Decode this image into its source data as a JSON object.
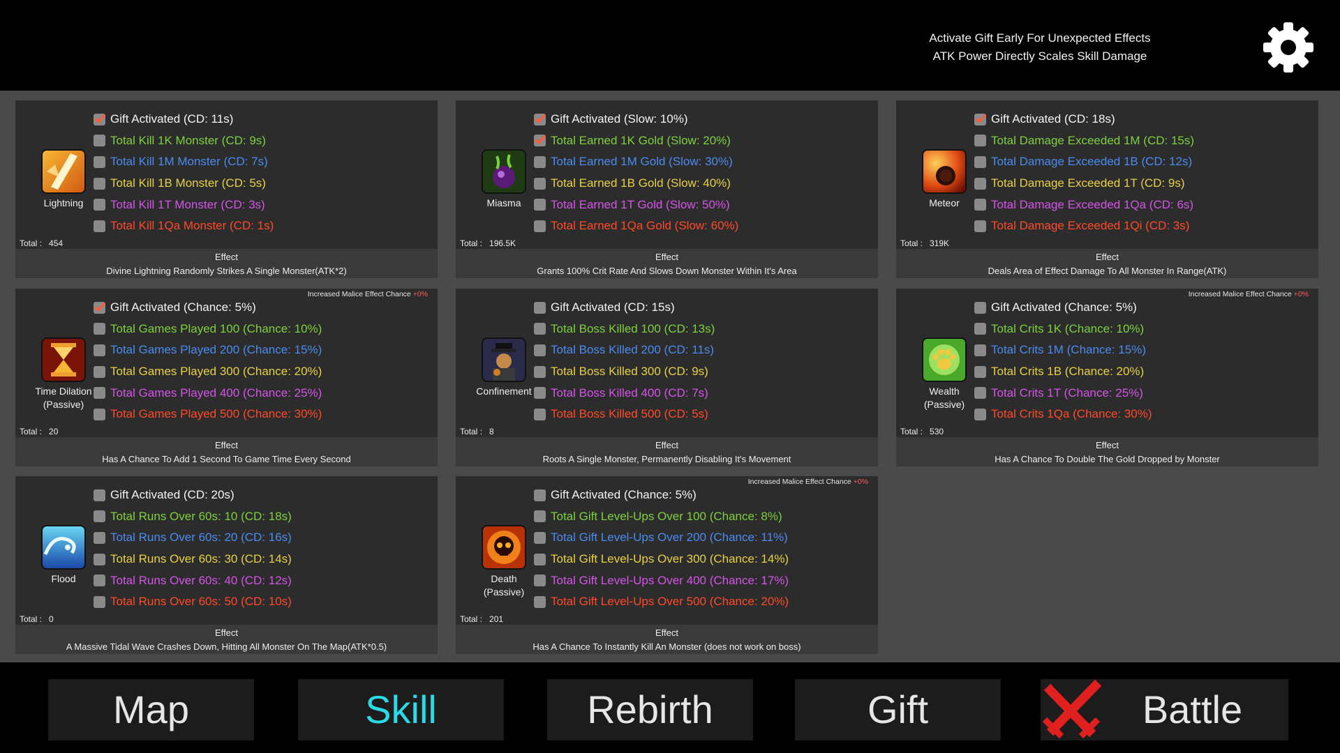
{
  "header": {
    "tips": [
      "Activate Gift Early For Unexpected Effects",
      "ATK Power Directly Scales Skill Damage"
    ]
  },
  "total_label": "Total :",
  "effect_label": "Effect",
  "malice_label": "Increased Malice Effect Chance",
  "malice_value": "+0%",
  "skills": [
    {
      "name": "Lightning",
      "icon": "lightning-icon",
      "total": "454",
      "malice": false,
      "conditions": [
        {
          "text": "Gift Activated (CD: 11s)",
          "checked": true
        },
        {
          "text": "Total Kill 1K Monster (CD: 9s)",
          "checked": false
        },
        {
          "text": "Total Kill 1M Monster (CD: 7s)",
          "checked": false
        },
        {
          "text": "Total Kill 1B Monster (CD: 5s)",
          "checked": false
        },
        {
          "text": "Total Kill 1T Monster (CD: 3s)",
          "checked": false
        },
        {
          "text": "Total Kill 1Qa Monster (CD: 1s)",
          "checked": false
        }
      ],
      "effect": "Divine Lightning Randomly Strikes A Single Monster(ATK*2)"
    },
    {
      "name": "Miasma",
      "icon": "miasma-icon",
      "total": "196.5K",
      "malice": false,
      "conditions": [
        {
          "text": "Gift Activated (Slow: 10%)",
          "checked": true
        },
        {
          "text": "Total Earned 1K Gold (Slow: 20%)",
          "checked": true
        },
        {
          "text": "Total Earned 1M Gold (Slow: 30%)",
          "checked": false
        },
        {
          "text": "Total Earned 1B Gold (Slow: 40%)",
          "checked": false
        },
        {
          "text": "Total Earned 1T Gold (Slow: 50%)",
          "checked": false
        },
        {
          "text": "Total Earned 1Qa Gold (Slow: 60%)",
          "checked": false
        }
      ],
      "effect": "Grants 100% Crit Rate And Slows Down Monster Within It's Area"
    },
    {
      "name": "Meteor",
      "icon": "meteor-icon",
      "total": "319K",
      "malice": false,
      "conditions": [
        {
          "text": "Gift Activated (CD: 18s)",
          "checked": true
        },
        {
          "text": "Total Damage Exceeded 1M (CD: 15s)",
          "checked": false
        },
        {
          "text": "Total Damage Exceeded 1B (CD: 12s)",
          "checked": false
        },
        {
          "text": "Total Damage Exceeded 1T (CD: 9s)",
          "checked": false
        },
        {
          "text": "Total Damage Exceeded 1Qa (CD: 6s)",
          "checked": false
        },
        {
          "text": "Total Damage Exceeded 1Qi (CD: 3s)",
          "checked": false
        }
      ],
      "effect": "Deals Area of Effect Damage To All Monster In Range(ATK)"
    },
    {
      "name": "Time Dilation",
      "name2": "(Passive)",
      "icon": "hourglass-icon",
      "total": "20",
      "malice": true,
      "conditions": [
        {
          "text": "Gift Activated (Chance: 5%)",
          "checked": true
        },
        {
          "text": "Total Games Played 100 (Chance: 10%)",
          "checked": false
        },
        {
          "text": "Total Games Played 200 (Chance: 15%)",
          "checked": false
        },
        {
          "text": "Total Games Played 300 (Chance: 20%)",
          "checked": false
        },
        {
          "text": "Total Games Played 400 (Chance: 25%)",
          "checked": false
        },
        {
          "text": "Total Games Played 500 (Chance: 30%)",
          "checked": false
        }
      ],
      "effect": "Has A Chance To Add 1 Second To Game Time Every Second"
    },
    {
      "name": "Confinement",
      "icon": "confinement-icon",
      "total": "8",
      "malice": false,
      "conditions": [
        {
          "text": "Gift Activated (CD: 15s)",
          "checked": false
        },
        {
          "text": "Total Boss Killed 100 (CD: 13s)",
          "checked": false
        },
        {
          "text": "Total Boss Killed 200 (CD: 11s)",
          "checked": false
        },
        {
          "text": "Total Boss Killed 300 (CD: 9s)",
          "checked": false
        },
        {
          "text": "Total Boss Killed 400 (CD: 7s)",
          "checked": false
        },
        {
          "text": "Total Boss Killed 500 (CD: 5s)",
          "checked": false
        }
      ],
      "effect": "Roots A Single Monster, Permanently Disabling It's Movement"
    },
    {
      "name": "Wealth",
      "name2": "(Passive)",
      "icon": "paw-icon",
      "total": "530",
      "malice": true,
      "conditions": [
        {
          "text": "Gift Activated (Chance: 5%)",
          "checked": false
        },
        {
          "text": "Total Crits 1K (Chance: 10%)",
          "checked": false
        },
        {
          "text": "Total Crits 1M (Chance: 15%)",
          "checked": false
        },
        {
          "text": "Total Crits 1B (Chance: 20%)",
          "checked": false
        },
        {
          "text": "Total Crits 1T (Chance: 25%)",
          "checked": false
        },
        {
          "text": "Total Crits 1Qa (Chance: 30%)",
          "checked": false
        }
      ],
      "effect": "Has A Chance To Double The Gold Dropped by Monster"
    },
    {
      "name": "Flood",
      "icon": "flood-icon",
      "total": "0",
      "malice": false,
      "conditions": [
        {
          "text": "Gift Activated (CD: 20s)",
          "checked": false
        },
        {
          "text": "Total Runs Over 60s: 10 (CD: 18s)",
          "checked": false
        },
        {
          "text": "Total Runs Over 60s: 20 (CD: 16s)",
          "checked": false
        },
        {
          "text": "Total Runs Over 60s: 30 (CD: 14s)",
          "checked": false
        },
        {
          "text": "Total Runs Over 60s: 40 (CD: 12s)",
          "checked": false
        },
        {
          "text": "Total Runs Over 60s: 50 (CD: 10s)",
          "checked": false
        }
      ],
      "effect": "A Massive Tidal Wave Crashes Down, Hitting All Monster On The Map(ATK*0.5)"
    },
    {
      "name": "Death",
      "name2": "(Passive)",
      "icon": "skull-icon",
      "total": "201",
      "malice": true,
      "conditions": [
        {
          "text": "Gift Activated (Chance: 5%)",
          "checked": false
        },
        {
          "text": "Total Gift Level-Ups Over 100 (Chance: 8%)",
          "checked": false
        },
        {
          "text": "Total Gift Level-Ups Over 200 (Chance: 11%)",
          "checked": false
        },
        {
          "text": "Total Gift Level-Ups Over 300 (Chance: 14%)",
          "checked": false
        },
        {
          "text": "Total Gift Level-Ups Over 400 (Chance: 17%)",
          "checked": false
        },
        {
          "text": "Total Gift Level-Ups Over 500 (Chance: 20%)",
          "checked": false
        }
      ],
      "effect": "Has A Chance To Instantly Kill An Monster (does not work on boss)"
    }
  ],
  "nav": [
    {
      "label": "Map",
      "active": false
    },
    {
      "label": "Skill",
      "active": true
    },
    {
      "label": "Rebirth",
      "active": false
    },
    {
      "label": "Gift",
      "active": false
    },
    {
      "label": "Battle",
      "active": false
    }
  ],
  "colors": {
    "white": "#f4f4f4",
    "green": "#7ed13e",
    "blue": "#4a8cf0",
    "yellow": "#e8d146",
    "purple": "#d455e8",
    "red": "#ff4a2a",
    "active_nav": "#29dbe6"
  }
}
